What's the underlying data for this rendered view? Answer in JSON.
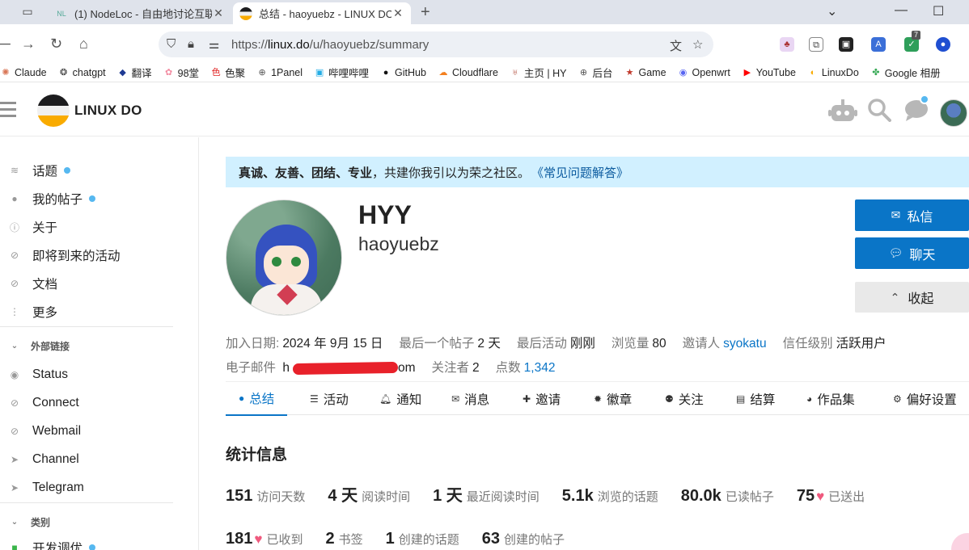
{
  "browser": {
    "tabs": [
      {
        "title": "(1) NodeLoc - 自由地讨论互联",
        "favicon": "NL"
      },
      {
        "title": "总结 - haoyuebz - LINUX DO"
      }
    ],
    "url_prefix": "https://",
    "url_host": "linux.do",
    "url_path": "/u/haoyuebz/summary",
    "ext_badge": "7",
    "bookmarks": [
      {
        "label": "Claude",
        "icon": "claude-icon",
        "color": "#d97757"
      },
      {
        "label": "chatgpt",
        "icon": "chatgpt-icon",
        "color": "#333333"
      },
      {
        "label": "翻译",
        "icon": "translate-icon",
        "color": "#1f3a93"
      },
      {
        "label": "98堂",
        "icon": "flower-icon",
        "color": "#f28aa0"
      },
      {
        "label": "色聚",
        "icon": "se-icon",
        "color": "#e02020"
      },
      {
        "label": "1Panel",
        "icon": "globe-icon",
        "color": "#555555"
      },
      {
        "label": "哔哩哔哩",
        "icon": "bilibili-icon",
        "color": "#23ade5"
      },
      {
        "label": "GitHub",
        "icon": "github-icon",
        "color": "#111111"
      },
      {
        "label": "Cloudflare",
        "icon": "cloudflare-icon",
        "color": "#f38020"
      },
      {
        "label": "主页 | HY",
        "icon": "home-bm-icon",
        "color": "#b04a3a"
      },
      {
        "label": "后台",
        "icon": "globe-icon",
        "color": "#555555"
      },
      {
        "label": "Game",
        "icon": "game-icon",
        "color": "#c0392b"
      },
      {
        "label": "Openwrt",
        "icon": "openwrt-icon",
        "color": "#5865f2"
      },
      {
        "label": "YouTube",
        "icon": "youtube-icon",
        "color": "#ff0000"
      },
      {
        "label": "LinuxDo",
        "icon": "linuxdo-icon",
        "color": "#f9ab00"
      },
      {
        "label": "Google 相册",
        "icon": "google-photos-icon",
        "color": "#34a853"
      }
    ]
  },
  "site": {
    "title": "LINUX DO"
  },
  "sidebar": {
    "items": [
      {
        "label": "话题",
        "icon": "layers-icon",
        "dot": true
      },
      {
        "label": "我的帖子",
        "icon": "user-icon",
        "dot": true
      },
      {
        "label": "关于",
        "icon": "info-icon",
        "dot": false
      },
      {
        "label": "即将到来的活动",
        "icon": "link-icon",
        "dot": false
      },
      {
        "label": "文档",
        "icon": "link-icon",
        "dot": false
      },
      {
        "label": "更多",
        "icon": "more-icon",
        "dot": false
      }
    ],
    "section_links": "外部链接",
    "links": [
      {
        "label": "Status",
        "icon": "eye-icon"
      },
      {
        "label": "Connect",
        "icon": "link-icon"
      },
      {
        "label": "Webmail",
        "icon": "link-icon"
      },
      {
        "label": "Channel",
        "icon": "send-icon"
      },
      {
        "label": "Telegram",
        "icon": "send-icon"
      }
    ],
    "section_categories": "类别",
    "categories": [
      {
        "label": "开发调优",
        "dot": true
      }
    ]
  },
  "banner": {
    "bold": "真诚、友善、团结、专业",
    "text": "，共建你我引以为荣之社区。",
    "link": "《常见问题解答》"
  },
  "profile": {
    "name": "HYY",
    "username": "haoyuebz",
    "buttons": {
      "message": "私信",
      "chat": "聊天",
      "collapse": "收起"
    },
    "meta_row1": [
      {
        "label": "加入日期:",
        "value": "2024 年 9月 15 日",
        "link": false
      },
      {
        "label": "最后一个帖子",
        "value": "2 天",
        "link": false
      },
      {
        "label": "最后活动",
        "value": "刚刚",
        "link": false
      },
      {
        "label": "浏览量",
        "value": "80",
        "link": false
      },
      {
        "label": "邀请人",
        "value": "syokatu",
        "link": true
      },
      {
        "label": "信任级别",
        "value": "活跃用户",
        "link": false
      }
    ],
    "email_label": "电子邮件",
    "email_prefix": "h",
    "email_suffix": "om",
    "meta_row2": [
      {
        "label": "关注者",
        "value": "2",
        "link": false
      },
      {
        "label": "点数",
        "value": "1,342",
        "link": true
      }
    ],
    "tabs": [
      {
        "label": "总结",
        "icon": "user-icon",
        "active": true
      },
      {
        "label": "活动",
        "icon": "list-icon",
        "active": false
      },
      {
        "label": "通知",
        "icon": "bell-icon",
        "active": false
      },
      {
        "label": "消息",
        "icon": "envelope-icon",
        "active": false
      },
      {
        "label": "邀请",
        "icon": "user-plus-icon",
        "active": false
      },
      {
        "label": "徽章",
        "icon": "badge-icon",
        "active": false
      },
      {
        "label": "关注",
        "icon": "users-icon",
        "active": false
      },
      {
        "label": "结算",
        "icon": "card-icon",
        "active": false
      },
      {
        "label": "作品集",
        "icon": "palette-icon",
        "active": false
      },
      {
        "label": "偏好设置",
        "icon": "gear-icon",
        "active": false
      }
    ]
  },
  "stats": {
    "title": "统计信息",
    "row1": [
      {
        "value": "151",
        "label": "访问天数",
        "heart": false
      },
      {
        "value": "4 天",
        "label": "阅读时间",
        "heart": false
      },
      {
        "value": "1 天",
        "label": "最近阅读时间",
        "heart": false
      },
      {
        "value": "5.1k",
        "label": "浏览的话题",
        "heart": false
      },
      {
        "value": "80.0k",
        "label": "已读帖子",
        "heart": false
      },
      {
        "value": "75",
        "label": "已送出",
        "heart": true
      }
    ],
    "row2": [
      {
        "value": "181",
        "label": "已收到",
        "heart": true
      },
      {
        "value": "2",
        "label": "书签",
        "heart": false
      },
      {
        "value": "1",
        "label": "创建的话题",
        "heart": false
      },
      {
        "value": "63",
        "label": "创建的帖子",
        "heart": false
      }
    ]
  }
}
